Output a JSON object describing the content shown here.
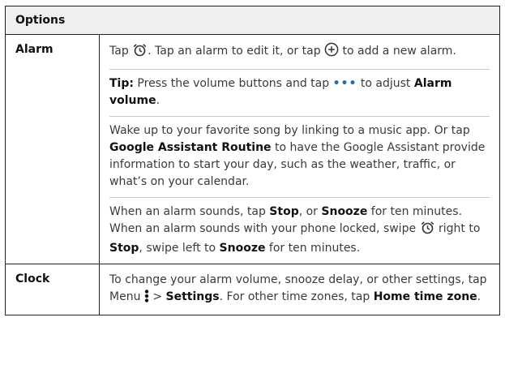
{
  "header": {
    "title": "Options"
  },
  "rows": [
    {
      "label": "Alarm",
      "paras": [
        {
          "t1": "Tap ",
          "t2": ". Tap an alarm to edit it, or tap ",
          "t3": " to add a new alarm."
        },
        {
          "b1": "Tip:",
          "t1": " Press the volume buttons and tap ",
          "dots": "•••",
          "t2": " to adjust ",
          "b2": "Alarm volume",
          "t3": "."
        },
        {
          "t1": "Wake up to your favorite song by linking to a music app. Or tap ",
          "b1": "Google Assistant Routine",
          "t2": " to have the Google Assistant provide information to start your day, such as the weather, traffic, or what’s on your calendar."
        },
        {
          "t1": "When an alarm sounds, tap ",
          "b1": "Stop",
          "t2": ", or ",
          "b2": "Snooze",
          "t3": " for ten minutes. When an alarm sounds with your phone locked, swipe ",
          "t4": " right to ",
          "b3": "Stop",
          "t5": ", swipe left to ",
          "b4": "Snooze",
          "t6": " for ten minutes."
        }
      ]
    },
    {
      "label": "Clock",
      "paras": [
        {
          "t1": "To change your alarm volume, snooze delay, or other settings, tap Menu ",
          "t2": " > ",
          "b1": "Settings",
          "t3": ". For other time zones, tap ",
          "b2": "Home time zone",
          "t4": "."
        }
      ]
    }
  ],
  "icons": {
    "alarm": "alarm-clock-icon",
    "add": "add-circle-icon",
    "more": "more-dots-icon",
    "menu": "vertical-menu-icon"
  },
  "colors": {
    "accent": "#1f6fb2",
    "header_bg": "#efefef",
    "border": "#222222"
  }
}
